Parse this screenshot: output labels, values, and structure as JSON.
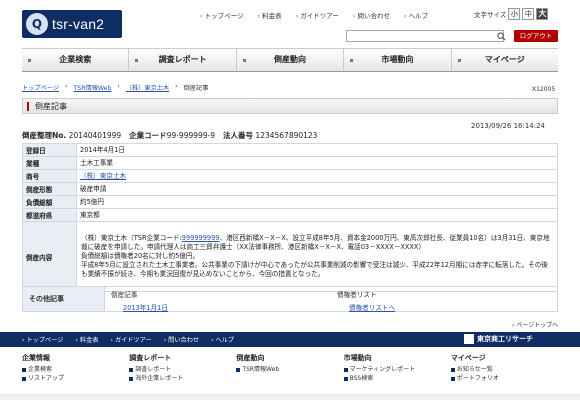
{
  "header": {
    "logo_text": "tsr-van2",
    "top_links": [
      "トップページ",
      "料金表",
      "ガイドツアー",
      "問い合わせ",
      "ヘルプ"
    ],
    "font_size_label": "文字サイズ",
    "font_size_buttons": [
      "小",
      "中",
      "大"
    ],
    "search_placeholder": "",
    "logout_label": "ログアウト"
  },
  "main_nav": {
    "items": [
      "企業検索",
      "調査レポート",
      "倒産動向",
      "市場動向",
      "マイページ"
    ]
  },
  "breadcrumb": {
    "items": [
      "トップページ",
      "TSR情報Web",
      "（株）東京土木",
      "倒産記事"
    ]
  },
  "page_id": "X12005",
  "section_title": "倒産記事",
  "date": "2013/09/26 16:14:24",
  "meta": {
    "manage_label": "倒産整理No.",
    "manage_value": "20140401999",
    "company_code_label": "企業コード",
    "company_code_value": "99-999999-9",
    "corp_number_label": "法人番号",
    "corp_number_value": "1234567890123"
  },
  "detail": {
    "registration_date_label": "登録日",
    "registration_date": "2014年4月1日",
    "industry_label": "業種",
    "industry": "土木工事業",
    "trade_name_label": "商号",
    "trade_name": "（株）東京土木",
    "form_label": "倒産形態",
    "form": "破産申請",
    "liabilities_label": "負債総額",
    "liabilities": "約5億円",
    "prefecture_label": "都道府県",
    "prefecture": "東京都",
    "content_label": "倒産内容",
    "content_prefix": "（株）東京土木（TSR企業コード:",
    "content_code_link": "999999999",
    "content_body": "、港区西新橋X－X－X、設立平成8年5月、資本金2000万円、東高次郎社長、従業員10名）は3月31日、東京地裁に破産を申請した。申請代理人は商工三郎弁護士（XX法律事務所、港区新橋X－X－X、電話03－XXXX－XXXX）",
    "content_line2": "負債総額は債権者20名に対し約5億円。",
    "content_line3": "平成8年5月に設立された土木工事業者。公共事業の下請けが中心であったが公共事業削減の影響で受注は減少、平成22年12月期には赤字に転落した。その後も業績不振が続き、今期も業況回復が見込めないことから、今回の措置となった。"
  },
  "other_articles": {
    "label": "その他記事",
    "col1_header": "倒産記事",
    "col1_link": "2013年1月1日",
    "col2_header": "債権者リスト",
    "col2_link": "債権者リストへ"
  },
  "page_top": "ページトップへ",
  "footer": {
    "links": [
      "トップページ",
      "料金表",
      "ガイドツアー",
      "問い合わせ",
      "ヘルプ"
    ],
    "brand": "東京商工リサーチ",
    "sitemap": [
      {
        "heading": "企業情報",
        "items": [
          "企業検索",
          "リストアップ"
        ]
      },
      {
        "heading": "調査レポート",
        "items": [
          "調査レポート",
          "海外企業レポート"
        ]
      },
      {
        "heading": "倒産動向",
        "items": [
          "TSR情報Web"
        ]
      },
      {
        "heading": "市場動向",
        "items": [
          "マーケティングレポート",
          "BSS検索"
        ]
      },
      {
        "heading": "マイページ",
        "items": [
          "お知らせ一覧",
          "ポートフォリオ"
        ]
      }
    ]
  }
}
